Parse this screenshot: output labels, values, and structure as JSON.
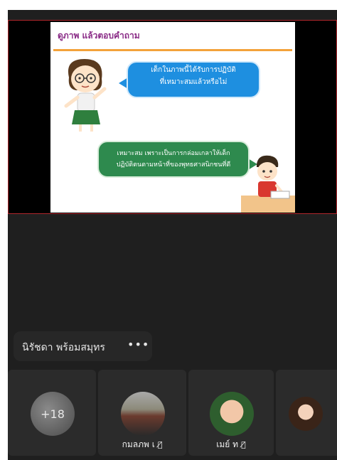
{
  "slide": {
    "title": "ดูภาพ แล้วตอบคำถาม",
    "question_line1": "เด็กในภาพนี้ได้รับการปฏิบัติ",
    "question_line2": "ที่เหมาะสมแล้วหรือไม่",
    "answer_line1": "เหมาะสม เพราะเป็นการกล่อมเกลาให้เด็ก",
    "answer_line2": "ปฏิบัติตนตามหน้าที่ของพุทธศาสนิกชนที่ดี"
  },
  "presenter": {
    "name": "นิรัชดา พร้อมสมุทร",
    "more": "•••"
  },
  "participants": [
    {
      "label": "+18"
    },
    {
      "label": "กมลภพ เ",
      "muted_icon": "mic-off-icon"
    },
    {
      "label": "เมย์ ท",
      "muted_icon": "mic-off-icon"
    },
    {
      "label": ""
    }
  ],
  "colors": {
    "accent_red": "#b0262c",
    "bubble_blue": "#1e8fe0",
    "bubble_green": "#2e8a4e",
    "title_purple": "#8a2b86",
    "background": "#1f1f1f"
  }
}
